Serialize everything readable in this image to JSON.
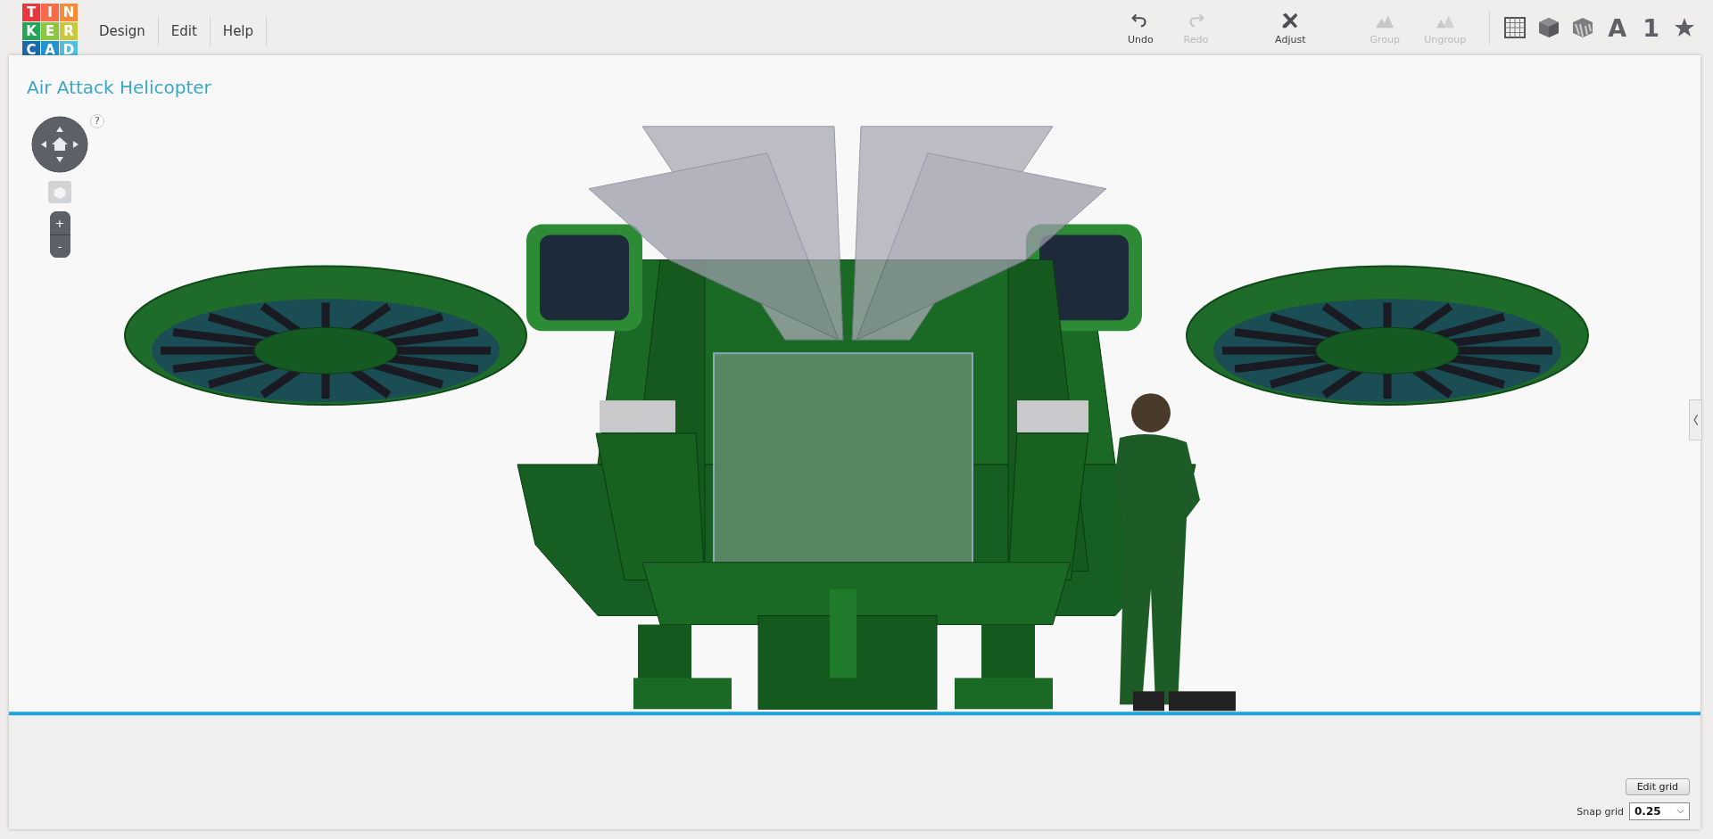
{
  "logo": {
    "letters": [
      {
        "char": "T",
        "color": "#e8383d"
      },
      {
        "char": "I",
        "color": "#f46c4a"
      },
      {
        "char": "N",
        "color": "#f58a3a"
      },
      {
        "char": "K",
        "color": "#22a557"
      },
      {
        "char": "E",
        "color": "#8cc63f"
      },
      {
        "char": "R",
        "color": "#c9c83a"
      },
      {
        "char": "C",
        "color": "#1a6aa8"
      },
      {
        "char": "A",
        "color": "#2594d0"
      },
      {
        "char": "D",
        "color": "#53bfdc"
      }
    ]
  },
  "menu": [
    "Design",
    "Edit",
    "Help"
  ],
  "toolbar": [
    {
      "kind": "undo",
      "label": "Undo",
      "disabled": false
    },
    {
      "kind": "redo",
      "label": "Redo",
      "disabled": true
    },
    {
      "kind": "adjust",
      "label": "Adjust",
      "disabled": false
    },
    {
      "kind": "group",
      "label": "Group",
      "disabled": true
    },
    {
      "kind": "ungroup",
      "label": "Ungroup",
      "disabled": true
    }
  ],
  "view_buttons": [
    {
      "kind": "grid"
    },
    {
      "kind": "box"
    },
    {
      "kind": "striped-box"
    },
    {
      "kind": "text",
      "label": "A"
    },
    {
      "kind": "text",
      "label": "1"
    },
    {
      "kind": "star"
    }
  ],
  "design_title": "Air Attack Helicopter",
  "help_button": "?",
  "zoom_controls": [
    "+",
    "-"
  ],
  "grid_controls": {
    "edit_button": "Edit grid",
    "snap_label": "Snap grid",
    "snap_value": "0.25"
  }
}
